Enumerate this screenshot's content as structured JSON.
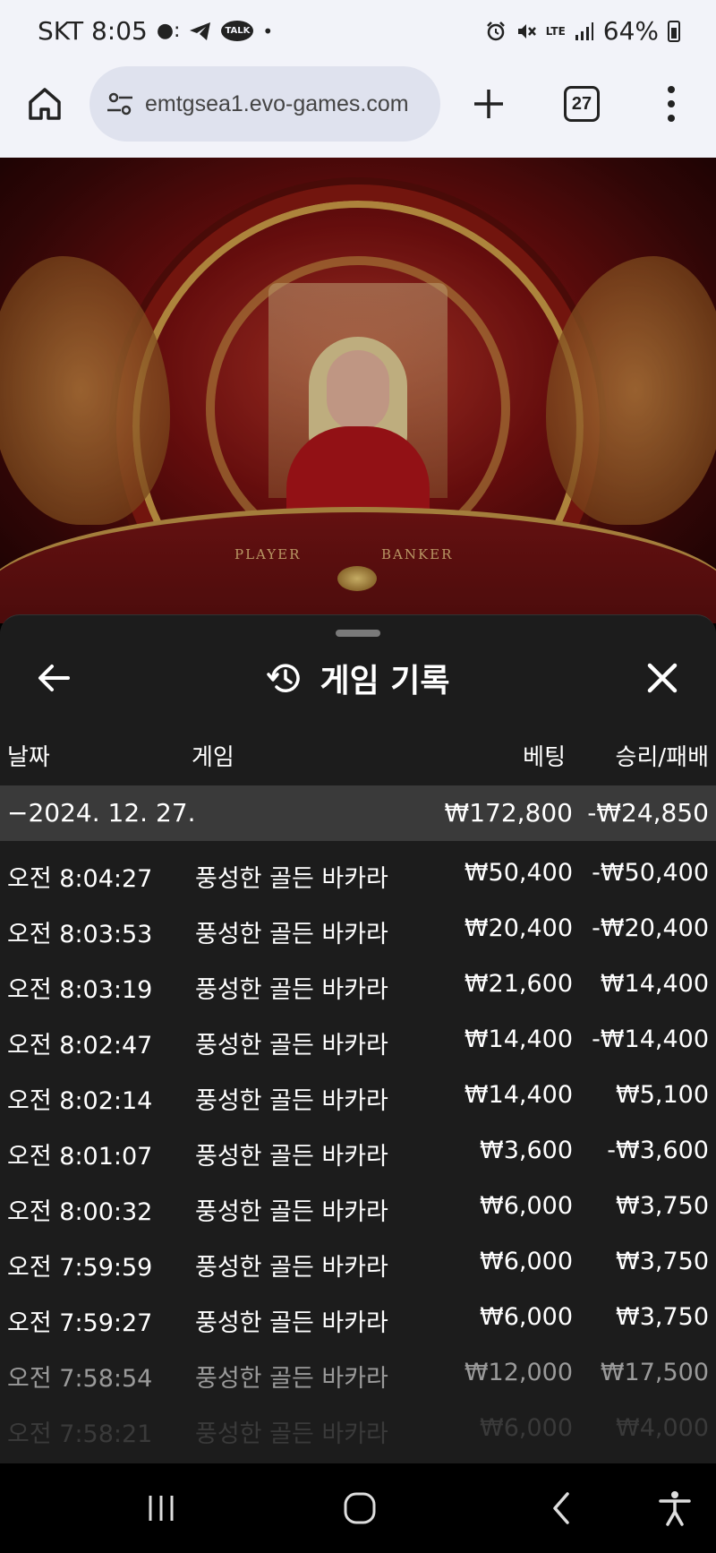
{
  "status_bar": {
    "carrier_time": "SKT 8:05",
    "notification_icons": [
      "camera-dot-icon",
      "telegram-icon",
      "talk-icon",
      "dot-icon"
    ],
    "talk_label": "TALK",
    "right_icons": [
      "alarm-icon",
      "mute-icon",
      "lte-icon",
      "signal-icon"
    ],
    "lte_label": "LTE",
    "battery": "64%"
  },
  "browser": {
    "url": "emtgsea1.evo-games.com",
    "tab_count": "27"
  },
  "video": {
    "player_label": "PLAYER",
    "banker_label": "BANKER"
  },
  "sheet": {
    "title": "게임 기록",
    "headers": {
      "date": "날짜",
      "game": "게임",
      "bet": "베팅",
      "win_loss": "승리/패배"
    },
    "summary": {
      "date": "−2024. 12. 27.",
      "bet": "₩172,800",
      "win_loss": "-₩24,850"
    },
    "rows": [
      {
        "time": "오전 8:04:27",
        "game": "풍성한 골든 바카라",
        "bet": "₩50,400",
        "win_loss": "-₩50,400"
      },
      {
        "time": "오전 8:03:53",
        "game": "풍성한 골든 바카라",
        "bet": "₩20,400",
        "win_loss": "-₩20,400"
      },
      {
        "time": "오전 8:03:19",
        "game": "풍성한 골든 바카라",
        "bet": "₩21,600",
        "win_loss": "₩14,400"
      },
      {
        "time": "오전 8:02:47",
        "game": "풍성한 골든 바카라",
        "bet": "₩14,400",
        "win_loss": "-₩14,400"
      },
      {
        "time": "오전 8:02:14",
        "game": "풍성한 골든 바카라",
        "bet": "₩14,400",
        "win_loss": "₩5,100"
      },
      {
        "time": "오전 8:01:07",
        "game": "풍성한 골든 바카라",
        "bet": "₩3,600",
        "win_loss": "-₩3,600"
      },
      {
        "time": "오전 8:00:32",
        "game": "풍성한 골든 바카라",
        "bet": "₩6,000",
        "win_loss": "₩3,750"
      },
      {
        "time": "오전 7:59:59",
        "game": "풍성한 골든 바카라",
        "bet": "₩6,000",
        "win_loss": "₩3,750"
      },
      {
        "time": "오전 7:59:27",
        "game": "풍성한 골든 바카라",
        "bet": "₩6,000",
        "win_loss": "₩3,750"
      },
      {
        "time": "오전 7:58:54",
        "game": "풍성한 골든 바카라",
        "bet": "₩12,000",
        "win_loss": "₩17,500"
      },
      {
        "time": "오전 7:58:21",
        "game": "풍성한 골든 바카라",
        "bet": "₩6,000",
        "win_loss": "₩4,000"
      }
    ]
  },
  "colors": {
    "sheet_bg": "#1c1c1c",
    "summary_bg": "#3a3a3a",
    "browser_bg": "#f2f3f9",
    "url_pill_bg": "#dfe2ee"
  }
}
